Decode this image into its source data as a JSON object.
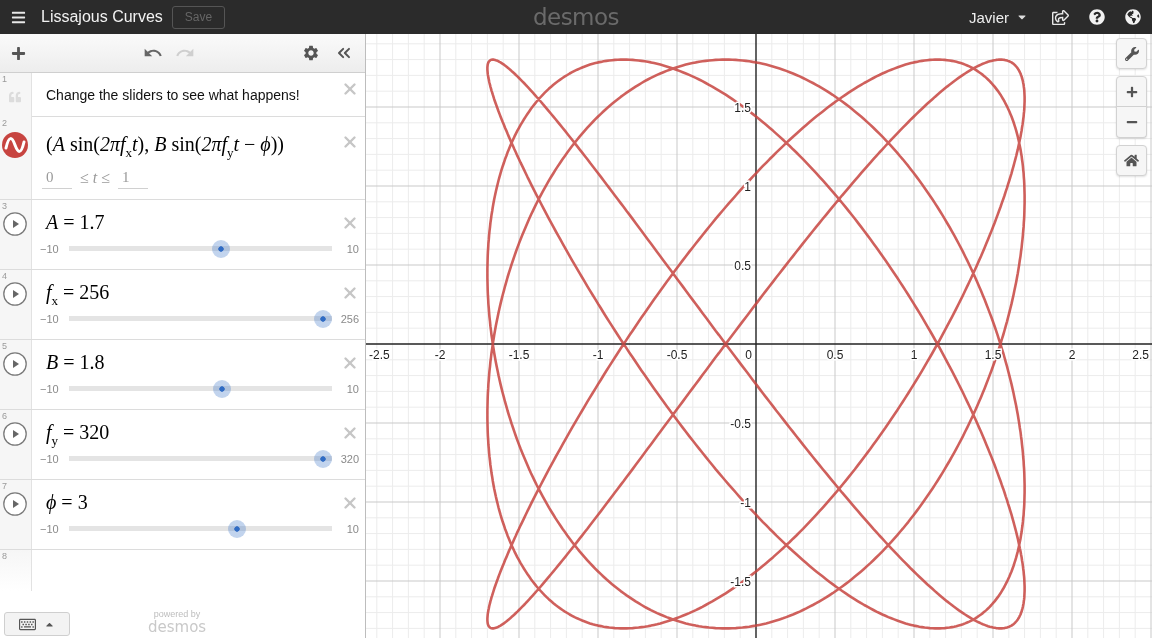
{
  "top_bar": {
    "title": "Lissajous Curves",
    "save_button": {
      "label": "Save",
      "disabled": true
    },
    "logo": "desmos",
    "user": "Javier"
  },
  "toolbar": {
    "undo_disabled": false,
    "redo_disabled": true
  },
  "expressions": [
    {
      "kind": "note",
      "number": "1",
      "text": "Change the sliders to see what happens!"
    },
    {
      "kind": "parametric",
      "number": "2",
      "latex": "(*A* sin(*2πf*$_{x}$*t*), *B* sin(*2πf*$_{y}$*t* − *ϕ*))",
      "domain": {
        "min": "0",
        "relation": "≤ *t* ≤",
        "max": "1"
      }
    },
    {
      "kind": "slider",
      "number": "3",
      "latex": "*A* = 1.7",
      "min": "−10",
      "max": "10",
      "level": 0.585
    },
    {
      "kind": "slider",
      "number": "4",
      "latex": "*f*$_{x}$ = 256",
      "min": "−10",
      "max": "256",
      "level": 1
    },
    {
      "kind": "slider",
      "number": "5",
      "latex": "*B* = 1.8",
      "min": "−10",
      "max": "10",
      "level": 0.59
    },
    {
      "kind": "slider",
      "number": "6",
      "latex": "*f*$_{y}$ = 320",
      "min": "−10",
      "max": "320",
      "level": 1
    },
    {
      "kind": "slider",
      "number": "7",
      "latex": "*ϕ* = 3",
      "min": "−10",
      "max": "10",
      "level": 0.65
    },
    {
      "kind": "empty",
      "number": "8"
    }
  ],
  "footer": {
    "powered_by": "powered by",
    "brand": "desmos"
  },
  "graph": {
    "x_ticks": [
      "-2.5",
      "-2",
      "-1.5",
      "-1",
      "-0.5",
      "0",
      "0.5",
      "1",
      "1.5",
      "2",
      "2.5"
    ],
    "y_ticks": [
      "1.5",
      "1",
      "0.5",
      "-0.5",
      "-1",
      "-1.5"
    ]
  }
}
